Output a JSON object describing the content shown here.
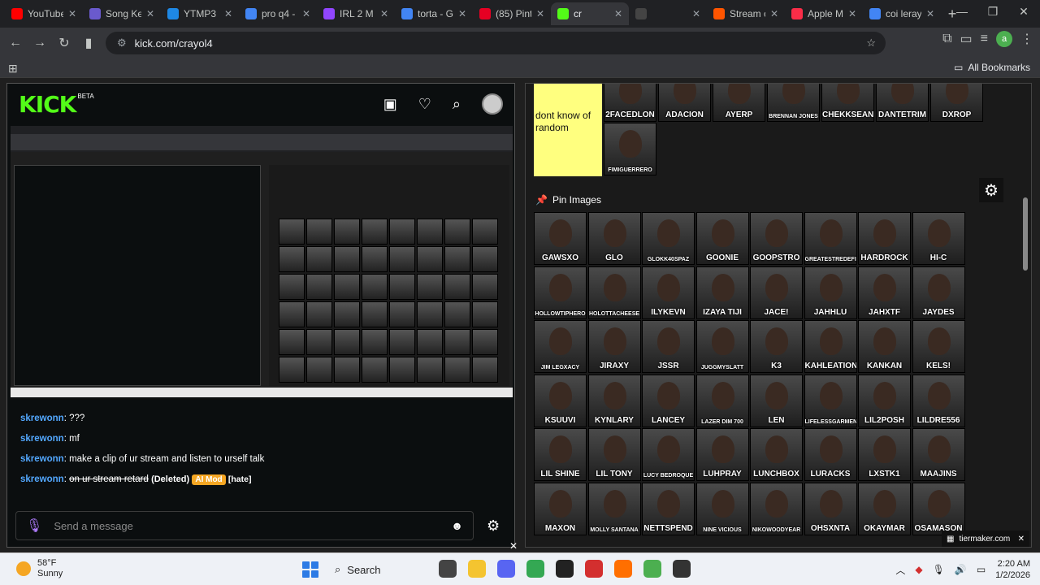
{
  "browser": {
    "tabs": [
      {
        "label": "YouTube",
        "color": "#ff0000"
      },
      {
        "label": "Song Ke",
        "color": "#6a5acd"
      },
      {
        "label": "YTMP3",
        "color": "#1e88e5"
      },
      {
        "label": "pro q4 -",
        "color": "#4285f4"
      },
      {
        "label": "IRL 2 M",
        "color": "#9146ff"
      },
      {
        "label": "torta - G",
        "color": "#4285f4"
      },
      {
        "label": "(85) Pint",
        "color": "#e60023"
      },
      {
        "label": "cr",
        "color": "#53fc18",
        "active": true
      },
      {
        "label": "",
        "color": "#444444"
      },
      {
        "label": "Stream c",
        "color": "#ff5500"
      },
      {
        "label": "Apple M",
        "color": "#fa2d48"
      },
      {
        "label": "coi leray",
        "color": "#4285f4"
      }
    ],
    "url": "kick.com/crayol4",
    "profile_initial": "a",
    "bookmarks_all": "All Bookmarks"
  },
  "kick": {
    "logo": "KICK",
    "beta": "BETA",
    "chat": [
      {
        "user": "skrewonn",
        "text": "???"
      },
      {
        "user": "skrewonn",
        "text": "mf"
      },
      {
        "user": "skrewonn",
        "text": "make a clip of ur stream and listen to urself talk"
      },
      {
        "user": "skrewonn",
        "text": "on ur stream retard",
        "deleted": "(Deleted)",
        "badge": "AI Mod",
        "tag": "[hate]"
      }
    ],
    "send_placeholder": "Send a message"
  },
  "tiermaker": {
    "top_tier_label": "dont know of random",
    "top_tier_items": [
      "2FACEDLON",
      "ADACION",
      "AYERP",
      "BRENNAN JONES",
      "CHEKKSEAN",
      "DANTETRIM",
      "DXROP",
      "FIMIGUERRERO"
    ],
    "pin_header": "Pin Images",
    "pin_items": [
      "GAWSXO",
      "GLO",
      "GLOKK40SPAZ",
      "GOONIE",
      "GOOPSTRO",
      "GREATESTREDEFINED",
      "HARDROCK",
      "HI-C",
      "HOLLOWTIPHERO",
      "HOLOTTACHEESE",
      "ILYKEVN",
      "IZAYA TIJI",
      "JACE!",
      "JAHHLU",
      "JAHXTF",
      "JAYDES",
      "JIM LEGXACY",
      "JIRAXY",
      "JSSR",
      "JUGGMYSLATT",
      "K3",
      "KAHLEATION",
      "KANKAN",
      "KELS!",
      "KSUUVI",
      "KYNLARY",
      "LANCEY",
      "LAZER DIM 700",
      "LEN",
      "LIFELESSGARMENTS",
      "LIL2POSH",
      "LILDRE556",
      "LIL SHINE",
      "LIL TONY",
      "LUCY BEDROQUE",
      "LUHPRAY",
      "LUNCHBOX",
      "LURACKS",
      "LXSTK1",
      "MAAJINS",
      "MAXON",
      "MOLLY SANTANA",
      "NETTSPEND",
      "NINE VICIOUS",
      "NIKOWOODYEAR",
      "OHSXNTA",
      "OKAYMAR",
      "OSAMASON"
    ],
    "badge": "tiermaker.com"
  },
  "taskbar": {
    "temp": "58°F",
    "condition": "Sunny",
    "search": "Search",
    "time": "2:20 AM",
    "date": "1/2/2026"
  }
}
